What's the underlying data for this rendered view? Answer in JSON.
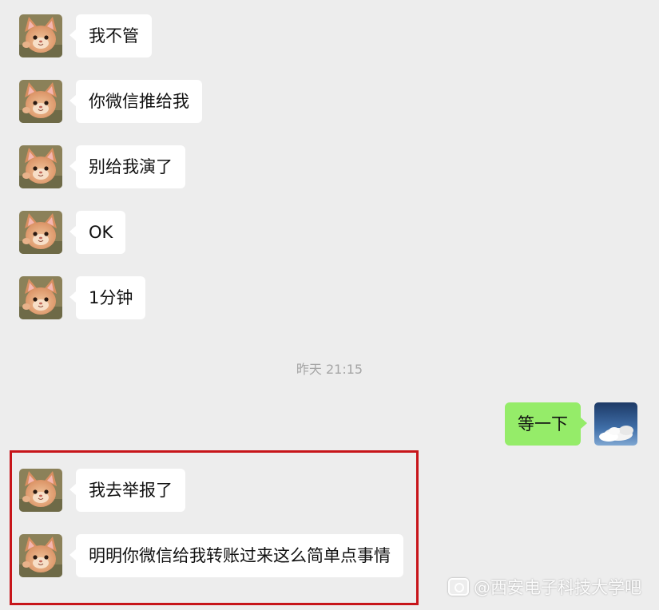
{
  "timestamp": "昨天 21:15",
  "messages": [
    {
      "text": "我不管"
    },
    {
      "text": "你微信推给我"
    },
    {
      "text": "别给我演了"
    },
    {
      "text": "OK"
    },
    {
      "text": "1分钟"
    },
    {
      "text": "等一下"
    },
    {
      "text": "我去举报了"
    },
    {
      "text": "明明你微信给我转账过来这么简单点事情"
    }
  ],
  "watermark": "@西安电子科技大学吧",
  "colors": {
    "background": "#ededed",
    "incoming_bubble": "#ffffff",
    "outgoing_bubble": "#95ec69",
    "highlight_border": "#c7151a"
  },
  "icons": {
    "contact_avatar": "cat-avatar-icon",
    "self_avatar": "sky-cloud-avatar-icon"
  }
}
